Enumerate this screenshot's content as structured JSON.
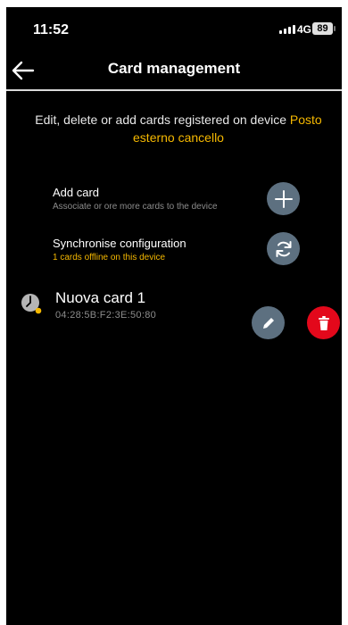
{
  "status_bar": {
    "time": "11:52",
    "network": "4G",
    "battery": "89"
  },
  "header": {
    "title": "Card management",
    "back_icon": "arrow-left-icon"
  },
  "intro": {
    "text": "Edit, delete or add cards registered on device ",
    "device_name": "Posto esterno cancello"
  },
  "actions": [
    {
      "title": "Add card",
      "subtitle": "Associate or ore more cards to the device",
      "icon": "plus-icon"
    },
    {
      "title": "Synchronise configuration",
      "subtitle": "1 cards offline on this device",
      "icon": "sync-icon"
    }
  ],
  "cards": [
    {
      "name": "Nuova card 1",
      "mac": "04:28:5B:F2:3E:50:80",
      "status_icon": "clock-icon",
      "edit_icon": "pencil-icon",
      "delete_icon": "trash-icon"
    }
  ],
  "colors": {
    "background": "#000000",
    "accent": "#f5b800",
    "button_grey": "#5d7080",
    "delete_red": "#e3081b"
  }
}
